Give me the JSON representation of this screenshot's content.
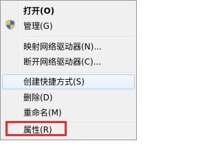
{
  "menu": {
    "items": [
      {
        "label": "打开(O)"
      },
      {
        "label": "管理(G)"
      },
      {
        "label": "映射网络驱动器(N)..."
      },
      {
        "label": "断开网络驱动器(C)..."
      },
      {
        "label": "创建快捷方式(S)"
      },
      {
        "label": "删除(D)"
      },
      {
        "label": "重命名(M)"
      },
      {
        "label": "属性(R)"
      }
    ]
  },
  "icons": {
    "admin_shield": "uac-shield-icon"
  },
  "colors": {
    "menu_background": "#f0f0f0",
    "hover_highlight_border": "#aecff7",
    "annotation_box": "#ee2b30"
  }
}
